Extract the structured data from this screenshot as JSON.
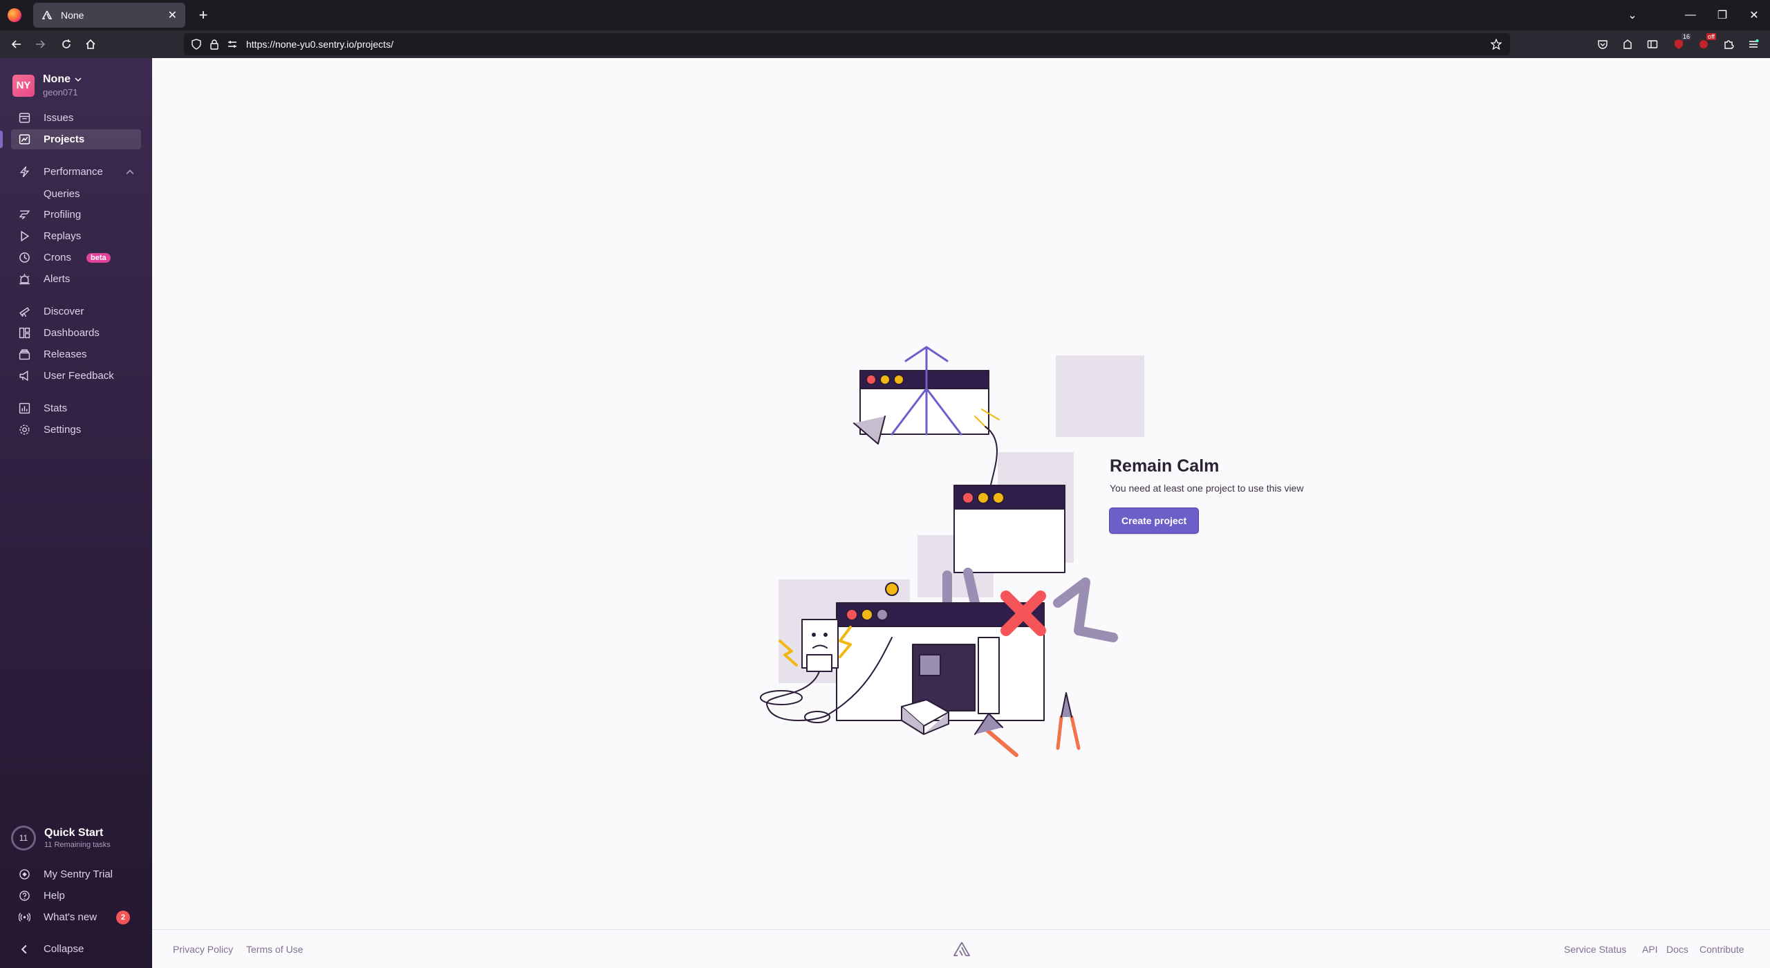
{
  "browser": {
    "tab_title": "None",
    "url": "https://none-yu0.sentry.io/projects/",
    "ext_badge_1": "16",
    "ext_badge_2": "off"
  },
  "org": {
    "avatar": "NY",
    "name": "None",
    "user": "geon071"
  },
  "sidebar": {
    "items": [
      {
        "label": "Issues",
        "icon": "issues-icon"
      },
      {
        "label": "Projects",
        "icon": "projects-icon",
        "active": true
      },
      {
        "label": "Performance",
        "icon": "performance-icon"
      },
      {
        "label": "Queries"
      },
      {
        "label": "Profiling",
        "icon": "profiling-icon"
      },
      {
        "label": "Replays",
        "icon": "replays-icon"
      },
      {
        "label": "Crons",
        "icon": "crons-icon",
        "badge": "beta"
      },
      {
        "label": "Alerts",
        "icon": "alerts-icon"
      },
      {
        "label": "Discover",
        "icon": "discover-icon"
      },
      {
        "label": "Dashboards",
        "icon": "dashboards-icon"
      },
      {
        "label": "Releases",
        "icon": "releases-icon"
      },
      {
        "label": "User Feedback",
        "icon": "feedback-icon"
      },
      {
        "label": "Stats",
        "icon": "stats-icon"
      },
      {
        "label": "Settings",
        "icon": "settings-icon"
      }
    ],
    "quick_start": {
      "count": "11",
      "title": "Quick Start",
      "subtitle": "11 Remaining tasks"
    },
    "bottom": [
      {
        "label": "My Sentry Trial",
        "icon": "trial-icon"
      },
      {
        "label": "Help",
        "icon": "help-icon"
      },
      {
        "label": "What's new",
        "icon": "broadcast-icon",
        "badge": "2"
      },
      {
        "label": "Collapse",
        "icon": "collapse-icon"
      }
    ]
  },
  "main": {
    "title": "Remain Calm",
    "message": "You need at least one project to use this view",
    "button": "Create project"
  },
  "footer": {
    "left": [
      "Privacy Policy",
      "Terms of Use"
    ],
    "right": [
      "Service Status",
      "API",
      "Docs",
      "Contribute"
    ]
  },
  "colors": {
    "sidebar_top": "#3b2b4e",
    "sidebar_bottom": "#24182f",
    "accent": "#6c5fc7",
    "org_avatar": "#e7488a",
    "badge_red": "#f55459",
    "beta_pink": "#e2419c"
  }
}
